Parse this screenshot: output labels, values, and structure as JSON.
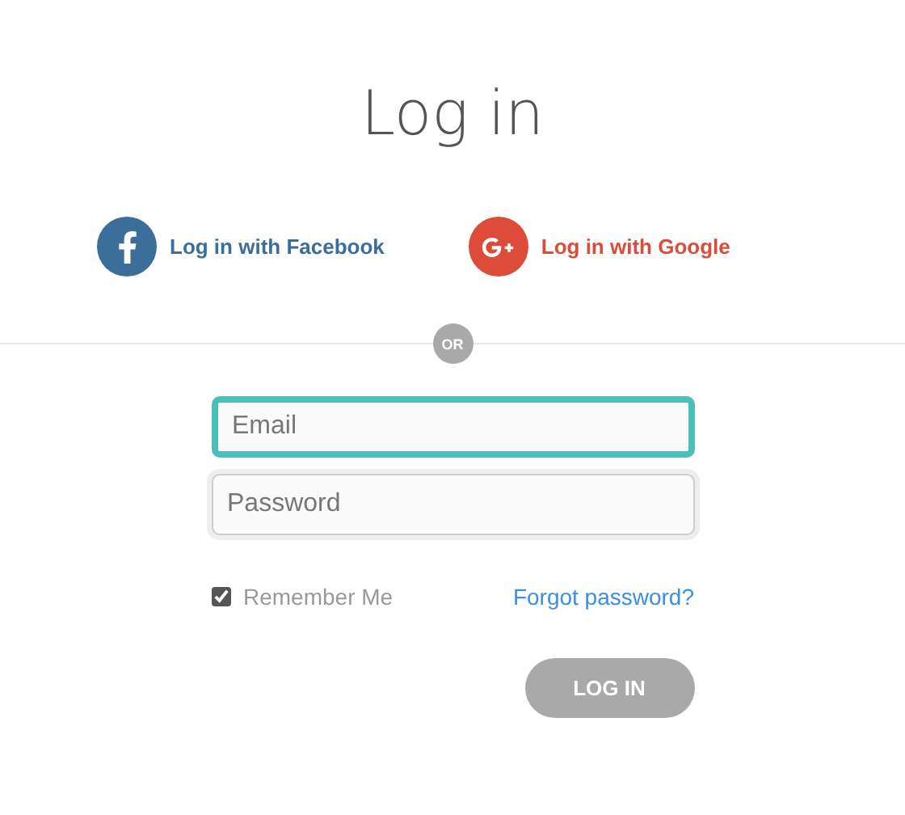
{
  "title": "Log in",
  "social": [
    {
      "kind": "facebook",
      "label": "Log in with Facebook",
      "color": "#3b6e99"
    },
    {
      "kind": "google",
      "label": "Log in with Google",
      "color": "#dd4b39"
    }
  ],
  "divider": {
    "label": "OR"
  },
  "fields": [
    {
      "placeholder": "Email",
      "focused": true
    },
    {
      "placeholder": "Password",
      "focused": false
    }
  ],
  "remember": {
    "label": "Remember Me",
    "checked": true
  },
  "forgot": {
    "label": "Forgot password?"
  },
  "submit": {
    "label": "LOG IN",
    "disabled": true
  }
}
